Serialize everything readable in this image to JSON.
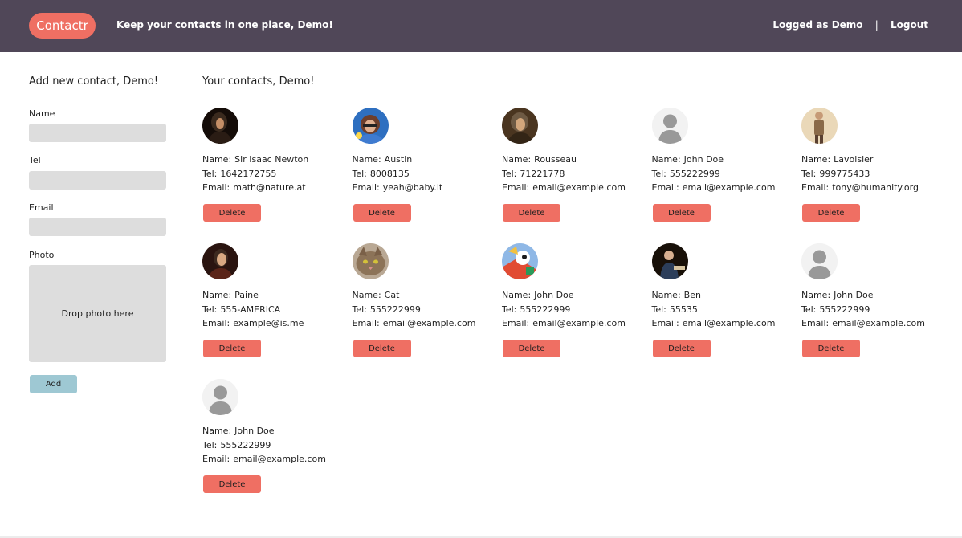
{
  "header": {
    "logo": "Contactr",
    "tagline": "Keep your contacts in one place, Demo!",
    "logged_as": "Logged as Demo",
    "separator": "|",
    "logout": "Logout"
  },
  "sidebar": {
    "title": "Add new contact, Demo!",
    "name_label": "Name",
    "name_value": "",
    "tel_label": "Tel",
    "tel_value": "",
    "email_label": "Email",
    "email_value": "",
    "photo_label": "Photo",
    "dropzone_text": "Drop photo here",
    "add_button": "Add"
  },
  "main": {
    "title": "Your contacts, Demo!",
    "labels": {
      "name": "Name:",
      "tel": "Tel:",
      "email": "Email:"
    },
    "delete_label": "Delete",
    "contacts": [
      {
        "name": "Sir Isaac Newton",
        "tel": "1642172755",
        "email": "math@nature.at",
        "avatar": "portrait-dark"
      },
      {
        "name": "Austin",
        "tel": "8008135",
        "email": "yeah@baby.it",
        "avatar": "portrait-blue"
      },
      {
        "name": "Rousseau",
        "tel": "71221778",
        "email": "email@example.com",
        "avatar": "portrait-brown"
      },
      {
        "name": "John Doe",
        "tel": "555222999",
        "email": "email@example.com",
        "avatar": "default-silhouette"
      },
      {
        "name": "Lavoisier",
        "tel": "999775433",
        "email": "tony@humanity.org",
        "avatar": "portrait-standing"
      },
      {
        "name": "Paine",
        "tel": "555-AMERICA",
        "email": "example@is.me",
        "avatar": "portrait-dark-red"
      },
      {
        "name": "Cat",
        "tel": "555222999",
        "email": "email@example.com",
        "avatar": "cat-photo"
      },
      {
        "name": "John Doe",
        "tel": "555222999",
        "email": "email@example.com",
        "avatar": "cartoon-colorful"
      },
      {
        "name": "Ben",
        "tel": "55535",
        "email": "email@example.com",
        "avatar": "portrait-seated"
      },
      {
        "name": "John Doe",
        "tel": "555222999",
        "email": "email@example.com",
        "avatar": "default-silhouette"
      },
      {
        "name": "John Doe",
        "tel": "555222999",
        "email": "email@example.com",
        "avatar": "default-silhouette"
      }
    ]
  },
  "colors": {
    "header_bg": "#504758",
    "accent": "#ef6f63",
    "add_button": "#9ec8d3",
    "input_bg": "#dddddd"
  }
}
